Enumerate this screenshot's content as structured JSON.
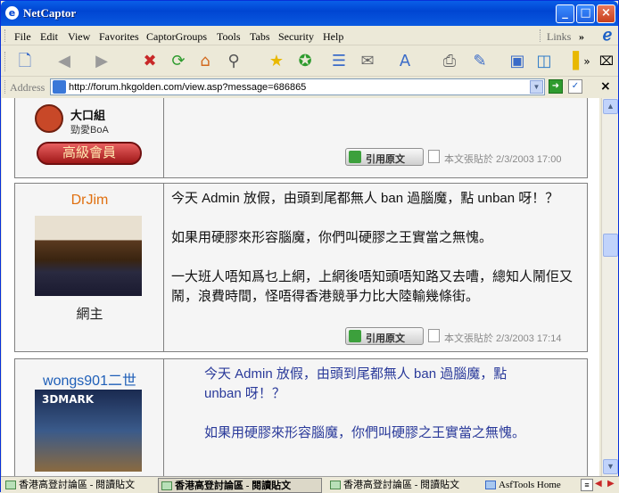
{
  "window": {
    "title": "NetCaptor",
    "app_icon": "netcaptor-logo-icon"
  },
  "menu": [
    "File",
    "Edit",
    "View",
    "Favorites",
    "CaptorGroups",
    "Tools",
    "Tabs",
    "Security",
    "Help"
  ],
  "links_label": "Links",
  "chevron": "»",
  "address": {
    "label": "Address",
    "url": "http://forum.hkgolden.com/view.asp?message=686865"
  },
  "posts": [
    {
      "username": "大口組",
      "user_subtitle": "勁愛BoA",
      "rank": "高級會員",
      "quote_label": "引用原文",
      "posted_at": "本文張貼於 2/3/2003 17:00"
    },
    {
      "username": "DrJim",
      "role": "網主",
      "paragraphs": [
        "今天 Admin 放假，由頭到尾都無人 ban 過腦魔，點 unban 呀！？",
        "如果用硬膠來形容腦魔，你們叫硬膠之王實當之無愧。",
        "一大班人唔知爲乜上網，上網後唔知頭唔知路又去嘈，總知人鬧佢又鬧，浪費時間，怪唔得香港競爭力比大陸輸幾條街。"
      ],
      "quote_label": "引用原文",
      "posted_at": "本文張貼於 2/3/2003 17:14"
    },
    {
      "username": "wongs901二世",
      "avatar_text": "3DMARK",
      "paragraphs": [
        "今天 Admin 放假，由頭到尾都無人 ban 過腦魔，點 unban 呀！？",
        "如果用硬膠來形容腦魔，你們叫硬膠之王實當之無愧。"
      ]
    }
  ],
  "taskbar": [
    {
      "label": "香港高登討論區 - 閱讀貼文",
      "active": false
    },
    {
      "label": "香港高登討論區 - 閱讀貼文",
      "active": true
    },
    {
      "label": "香港高登討論區 - 閱讀貼文",
      "active": false
    },
    {
      "label": "AsfTools Home",
      "active": false
    }
  ]
}
